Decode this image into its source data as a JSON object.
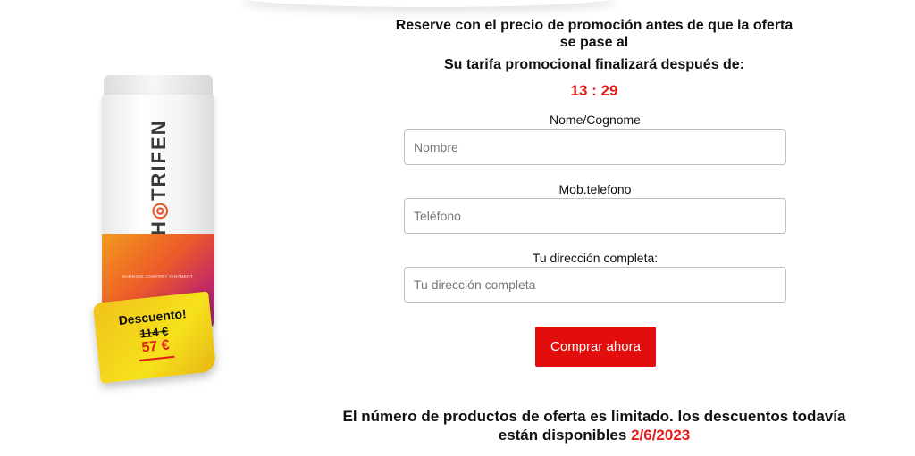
{
  "headline": {
    "line1": "Reserve con el precio de promoción antes de que la oferta",
    "line2": "se pase al",
    "line3": "Su tarifa promocional finalizará después de:"
  },
  "timer": {
    "minutes": "13",
    "separator": " : ",
    "seconds": "29"
  },
  "product": {
    "brand_prefix": "H",
    "brand_mark": "◎",
    "brand_suffix": "TRIFEN",
    "band_text": "WARMING COMFREY OINTMENT"
  },
  "sticker": {
    "title": "Descuento!",
    "old_price": "114 €",
    "new_price": "57 €"
  },
  "form": {
    "name": {
      "label": "Nome/Cognome",
      "placeholder": "Nombre",
      "value": ""
    },
    "phone": {
      "label": "Mob.telefono",
      "placeholder": "Teléfono",
      "value": ""
    },
    "address": {
      "label": "Tu dirección completa:",
      "placeholder": "Tu dirección completa",
      "value": ""
    },
    "submit_label": "Comprar ahora"
  },
  "footer": {
    "text_line1": "El número de productos de oferta es limitado. los descuentos todavía",
    "text_line2": "están disponibles",
    "date": "2/6/2023"
  },
  "colors": {
    "accent_red": "#e30d0d",
    "timer_red": "#e21b1b",
    "sticker_yellow": "#f6e11c"
  }
}
